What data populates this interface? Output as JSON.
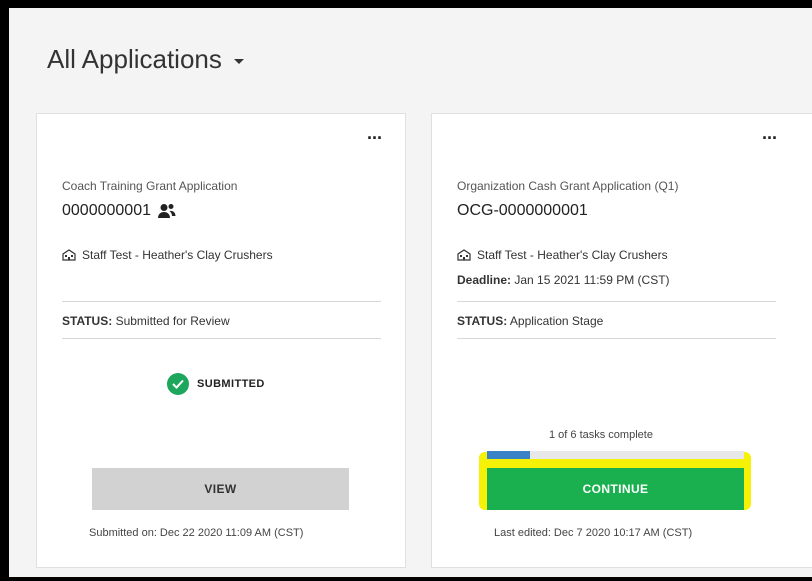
{
  "header": {
    "title": "All Applications"
  },
  "cards": [
    {
      "menu": "···",
      "app_type": "Coach Training Grant Application",
      "app_id": "0000000001",
      "org": "Staff Test - Heather's Clay Crushers",
      "status_label": "STATUS:",
      "status_value": "Submitted for Review",
      "badge": "SUBMITTED",
      "button": "VIEW",
      "footnote": "Submitted on: Dec 22 2020 11:09 AM (CST)"
    },
    {
      "menu": "···",
      "app_type": "Organization Cash Grant Application (Q1)",
      "app_id": "OCG-0000000001",
      "org": "Staff Test - Heather's Clay Crushers",
      "deadline_label": "Deadline:",
      "deadline_value": "Jan 15 2021 11:59 PM (CST)",
      "status_label": "STATUS:",
      "status_value": "Application Stage",
      "tasks": "1 of 6 tasks complete",
      "progress_fraction": 0.1667,
      "button": "CONTINUE",
      "footnote": "Last edited: Dec 7 2020 10:17 AM (CST)"
    }
  ],
  "icons": {
    "users": "users-icon",
    "building": "building-icon",
    "check": "check-circle-icon",
    "caret": "caret-down-icon",
    "menu": "more-icon"
  },
  "colors": {
    "success": "#1da75d",
    "primary": "#1ab04f",
    "progress": "#3a82c6",
    "highlight": "#f5f107"
  }
}
